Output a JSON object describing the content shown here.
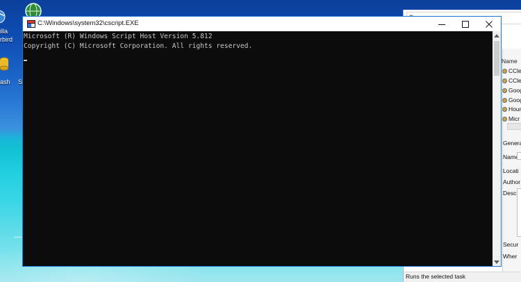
{
  "console": {
    "title": "C:\\Windows\\system32\\cscript.EXE",
    "lines": [
      "Microsoft (R) Windows Script Host Version 5.812",
      "Copyright (C) Microsoft Corporation. All rights reserved."
    ],
    "buttons": {
      "minimize": "minimize-icon",
      "maximize": "maximize-icon",
      "close": "close-icon"
    },
    "colors": {
      "background": "#0c0c0c",
      "text": "#c8c8c8",
      "border": "#1a76d2"
    }
  },
  "desktop": {
    "icons": [
      {
        "label_line1": "illa",
        "label_line2": "rbird",
        "icon": "thunderbird-globe-icon"
      },
      {
        "label_line1": "ash",
        "label_line2": "",
        "icon": "coins-icon"
      },
      {
        "label_line1": "S",
        "label_line2": "",
        "icon": "shortcut-icon"
      }
    ]
  },
  "task_scheduler": {
    "column_header": "Name",
    "tasks": [
      "CCle",
      "CCle",
      "Goog",
      "Goog",
      "Hour",
      "Micr"
    ],
    "tab": "General",
    "fields": [
      "Name:",
      "Locati",
      "Author",
      "Descri"
    ],
    "security_label": "Secur",
    "when_label": "Wher",
    "status": "Runs the selected task"
  }
}
